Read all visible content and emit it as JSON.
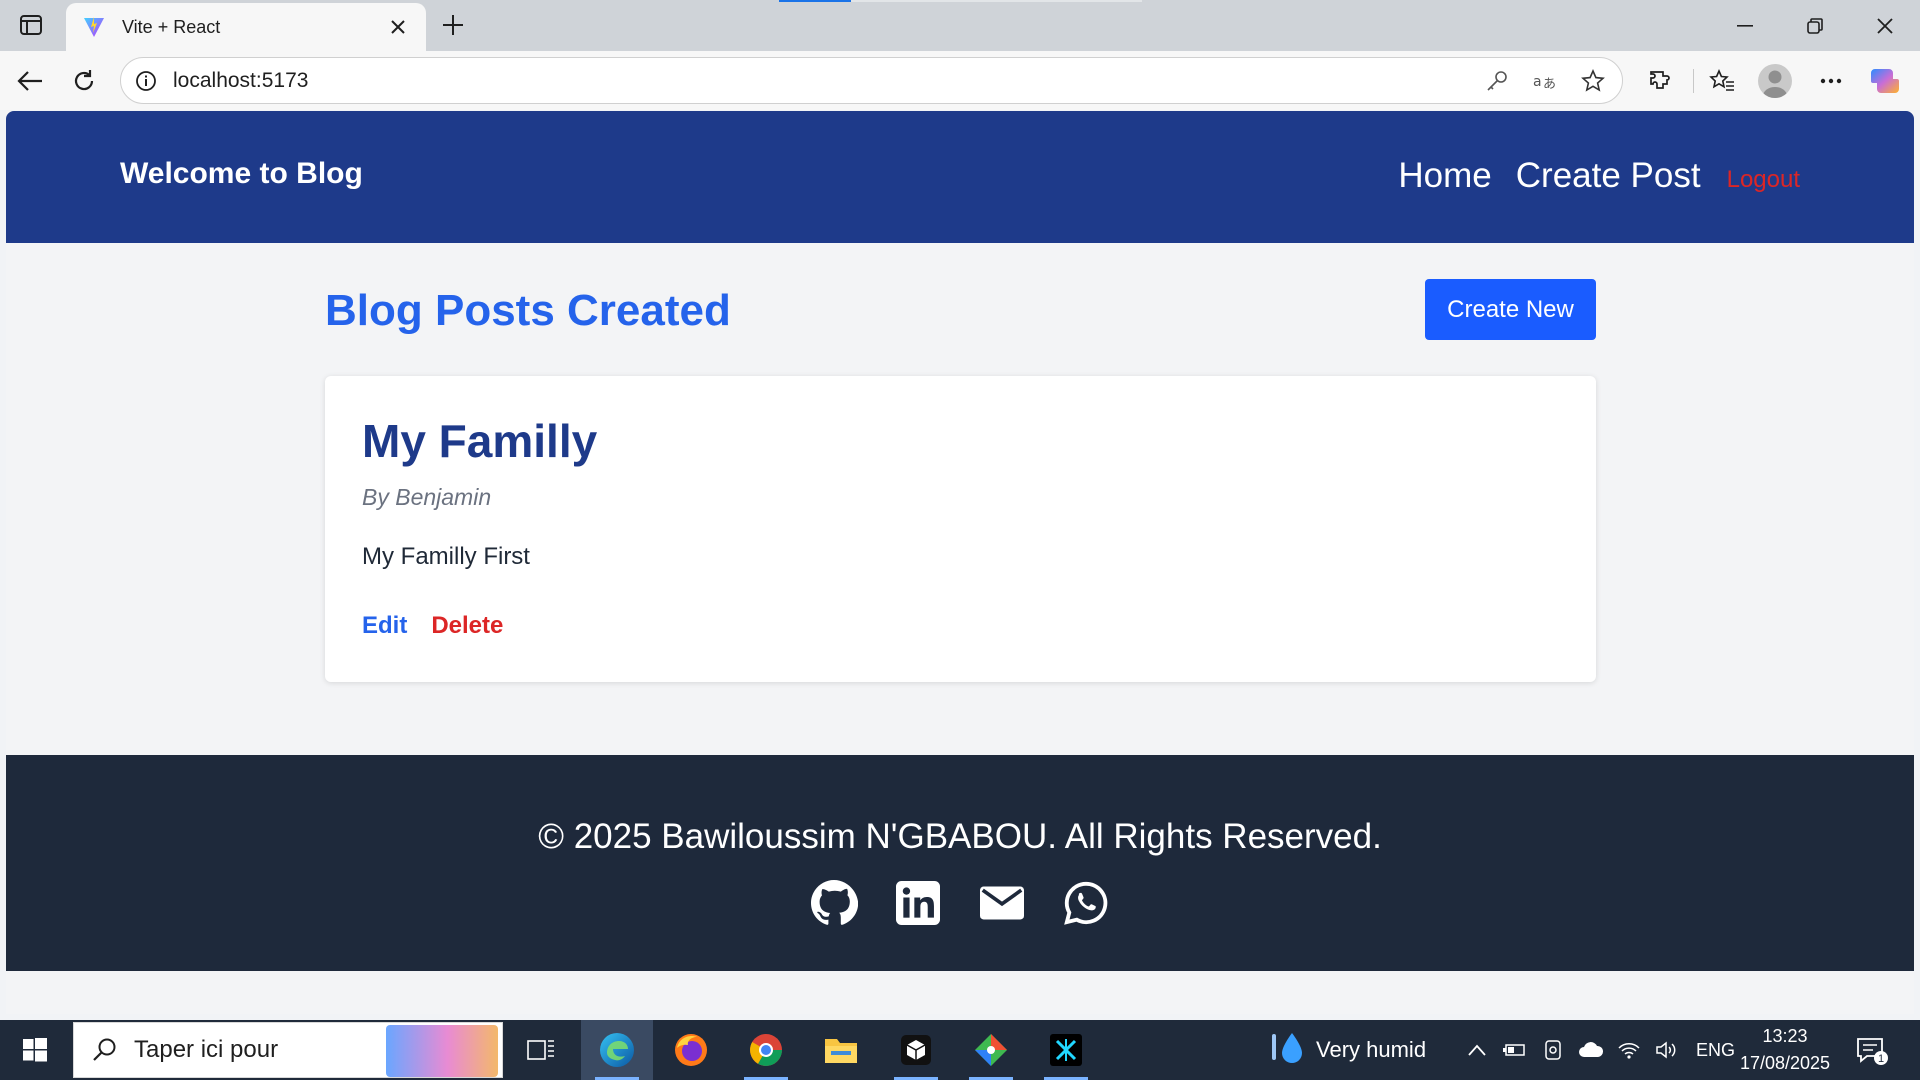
{
  "browser": {
    "tab_title": "Vite + React",
    "url": "localhost:5173"
  },
  "site": {
    "brand": "Welcome to Blog",
    "nav": {
      "home": "Home",
      "create_post": "Create Post",
      "logout": "Logout"
    },
    "colors": {
      "header": "#1e3a8a",
      "accent": "#2563eb",
      "danger": "#dc2626",
      "footer": "#1e293b"
    }
  },
  "main": {
    "heading": "Blog Posts Created",
    "create_button": "Create New",
    "posts": [
      {
        "title": "My Familly",
        "author": "By Benjamin",
        "body": "My Familly First",
        "edit": "Edit",
        "delete": "Delete"
      }
    ]
  },
  "footer": {
    "copyright": "© 2025 Bawiloussim N'GBABOU. All Rights Reserved.",
    "social_icons": [
      "github-icon",
      "linkedin-icon",
      "mail-icon",
      "whatsapp-icon"
    ]
  },
  "taskbar": {
    "search_placeholder": "Taper ici pour",
    "weather": "Very humid",
    "language": "ENG",
    "time": "13:23",
    "date": "17/08/2025",
    "notifications": "1"
  }
}
